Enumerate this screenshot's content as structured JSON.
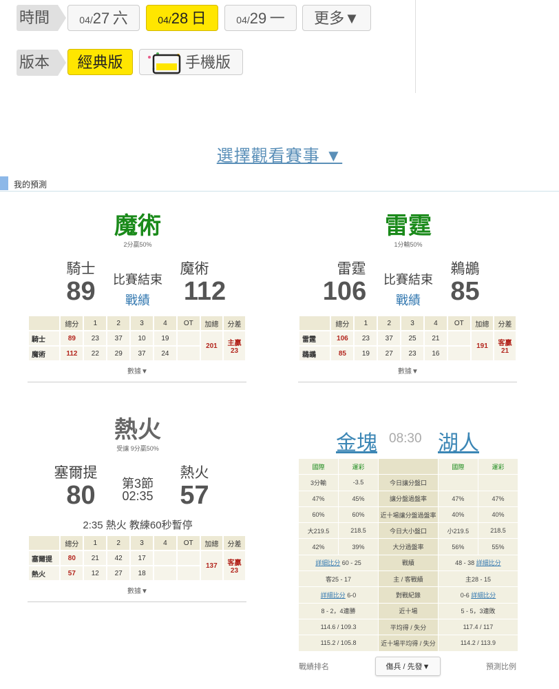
{
  "time_row": {
    "label": "時間",
    "dates": [
      {
        "month": "04/",
        "day": "27",
        "weekday": "六"
      },
      {
        "month": "04/",
        "day": "28",
        "weekday": "日"
      },
      {
        "month": "04/",
        "day": "29",
        "weekday": "一"
      }
    ],
    "more": "更多▼"
  },
  "version_row": {
    "label": "版本",
    "classic": "經典版",
    "mobile": "手機版"
  },
  "select_game": "選擇觀看賽事 ▼",
  "section_title": "我的預測",
  "games": [
    {
      "prediction": "魔術",
      "prediction_sub": "2分贏50%",
      "away": "騎士",
      "away_score": "89",
      "home": "魔術",
      "home_score": "112",
      "status": "比賽結束",
      "record": "戰績",
      "header": [
        "",
        "總分",
        "1",
        "2",
        "3",
        "4",
        "OT",
        "加總",
        "分差"
      ],
      "rows": [
        {
          "team": "騎士",
          "total": "89",
          "q": [
            "23",
            "37",
            "10",
            "19"
          ],
          "ot": ""
        },
        {
          "team": "魔術",
          "total": "112",
          "q": [
            "22",
            "29",
            "37",
            "24"
          ],
          "ot": ""
        }
      ],
      "sum": "201",
      "diff_label": "主贏",
      "diff": "23",
      "more": "數據▼"
    },
    {
      "prediction": "雷霆",
      "prediction_sub": "1分輸50%",
      "away": "雷霆",
      "away_score": "106",
      "home": "鵜鶘",
      "home_score": "85",
      "status": "比賽結束",
      "record": "戰績",
      "header": [
        "",
        "總分",
        "1",
        "2",
        "3",
        "4",
        "OT",
        "加總",
        "分差"
      ],
      "rows": [
        {
          "team": "雷霆",
          "total": "106",
          "q": [
            "23",
            "37",
            "25",
            "21"
          ],
          "ot": ""
        },
        {
          "team": "鵜鶘",
          "total": "85",
          "q": [
            "19",
            "27",
            "23",
            "16"
          ],
          "ot": ""
        }
      ],
      "sum": "191",
      "diff_label": "客贏",
      "diff": "21",
      "more": "數據▼"
    },
    {
      "prediction": "熱火",
      "prediction_sub": "受讓 9分贏50%",
      "away": "塞爾提",
      "away_score": "80",
      "home": "熱火",
      "home_score": "57",
      "status": "第3節",
      "clock": "02:35",
      "note": "2:35 熱火 教練60秒暫停",
      "header": [
        "",
        "總分",
        "1",
        "2",
        "3",
        "4",
        "OT",
        "加總",
        "分差"
      ],
      "rows": [
        {
          "team": "塞爾提",
          "total": "80",
          "q": [
            "21",
            "42",
            "17",
            ""
          ],
          "ot": ""
        },
        {
          "team": "熱火",
          "total": "57",
          "q": [
            "12",
            "27",
            "18",
            ""
          ],
          "ot": ""
        }
      ],
      "sum": "137",
      "diff_label": "客贏",
      "diff": "23",
      "more": "數據▼"
    }
  ],
  "upcoming": {
    "away": "金塊",
    "time": "08:30",
    "home": "湖人",
    "head": [
      "國際",
      "運彩",
      "",
      "國際",
      "運彩"
    ],
    "rows": [
      [
        "3分輸",
        "-3.5",
        "今日讓分盤口",
        "",
        ""
      ],
      [
        "47%",
        "45%",
        "讓分盤過盤率",
        "47%",
        "47%"
      ],
      [
        "60%",
        "60%",
        "近十場讓分盤過盤率",
        "40%",
        "40%"
      ],
      [
        "大219.5",
        "218.5",
        "今日大小盤口",
        "小219.5",
        "218.5"
      ],
      [
        "42%",
        "39%",
        "大分過盤率",
        "56%",
        "55%"
      ]
    ],
    "wide_rows": [
      {
        "left_link": "詳細比分",
        "left": " 60 - 25",
        "mid": "戰績",
        "right": "48 - 38 ",
        "right_link": "詳細比分"
      },
      {
        "left_link": "",
        "left": "客25 - 17",
        "mid": "主 / 客戰績",
        "right": "主28 - 15",
        "right_link": ""
      },
      {
        "left_link": "詳細比分",
        "left": " 6-0",
        "mid": "對戰紀錄",
        "right": "0-6 ",
        "right_link": "詳細比分"
      },
      {
        "left_link": "",
        "left": "8 - 2，4連勝",
        "mid": "近十場",
        "right": "5 - 5，3連敗",
        "right_link": ""
      },
      {
        "left_link": "",
        "left": "114.6 / 109.3",
        "mid": "平均得 / 失分",
        "right": "117.4 / 117",
        "right_link": ""
      },
      {
        "left_link": "",
        "left": "115.2 / 105.8",
        "mid": "近十場平均得 / 失分",
        "right": "114.2 / 113.9",
        "right_link": ""
      }
    ],
    "footer_left": "戰績排名",
    "footer_button": "傷兵 / 先發▼",
    "footer_right": "預測比例"
  }
}
